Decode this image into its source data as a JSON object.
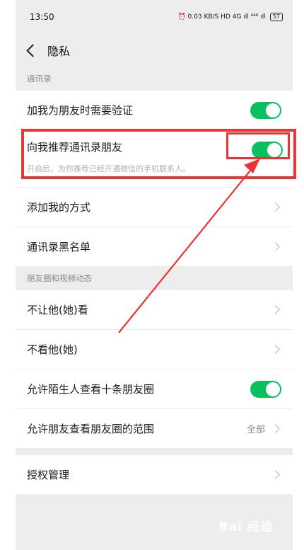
{
  "status_bar": {
    "time": "13:50",
    "indicators": "⏰ 0.03 KB/S HD 4G ıll ⁴⁴⁶ ıll",
    "battery": "57"
  },
  "nav": {
    "title": "隐私"
  },
  "sections": {
    "contacts_header": "通讯录",
    "moments_header": "朋友圈和视频动态"
  },
  "rows": {
    "verify_friend": {
      "label": "加我为朋友时需要验证",
      "enabled": true
    },
    "recommend_contacts": {
      "label": "向我推荐通讯录朋友",
      "desc": "开启后，为你推荐已经开通微信的手机联系人。",
      "enabled": true
    },
    "add_methods": {
      "label": "添加我的方式"
    },
    "blacklist": {
      "label": "通讯录黑名单"
    },
    "block_viewing": {
      "label": "不让他(她)看"
    },
    "dont_view": {
      "label": "不看他(她)"
    },
    "strangers_ten": {
      "label": "允许陌生人查看十条朋友圈",
      "enabled": true
    },
    "moments_range": {
      "label": "允许朋友查看朋友圈的范围",
      "value": "全部"
    },
    "auth_manage": {
      "label": "授权管理"
    }
  },
  "colors": {
    "toggle_on": "#07c160",
    "highlight": "#ee3333"
  },
  "watermark": "Bai 经验"
}
